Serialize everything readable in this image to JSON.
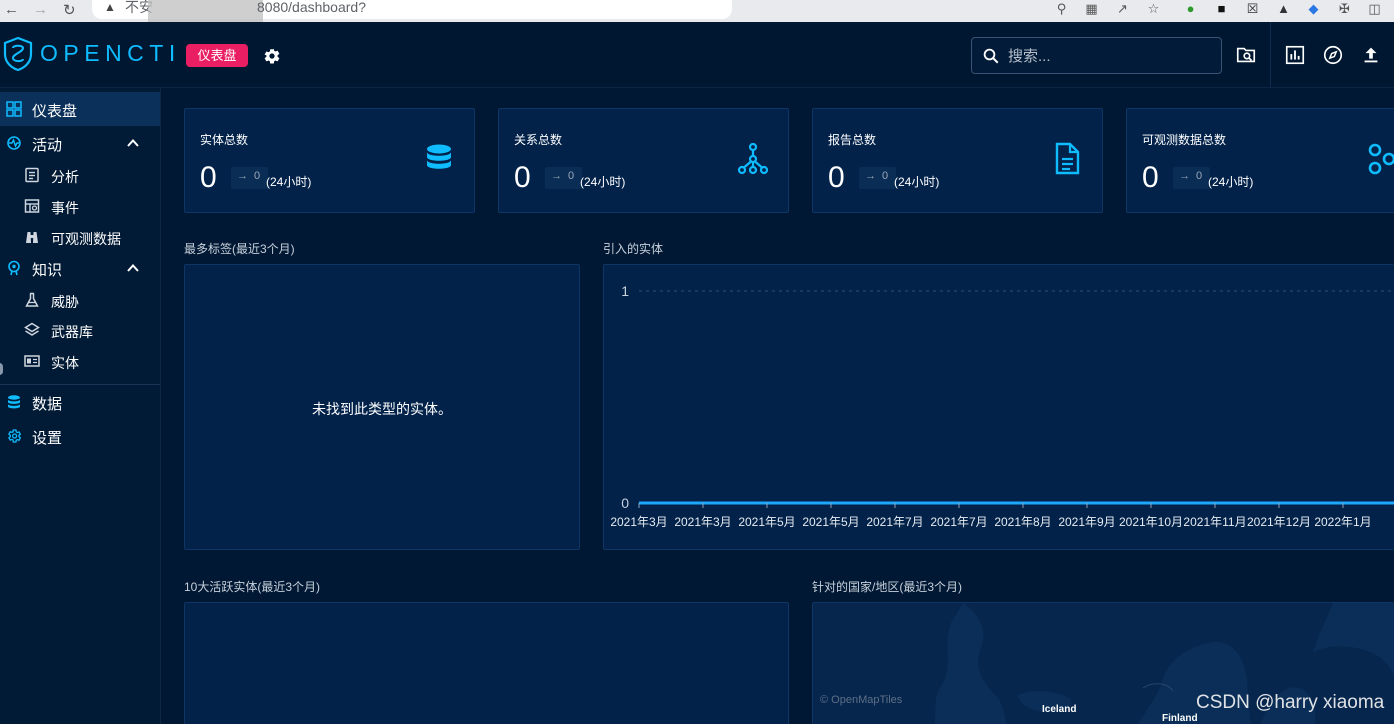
{
  "browser": {
    "insecure_label": "不安",
    "url": "8080/dashboard?"
  },
  "app": {
    "logo_text": "OPENCTI",
    "current_page_chip": "仪表盘",
    "search_placeholder": "搜索...",
    "accent": "#0fbcff",
    "chip_color": "#e91e63"
  },
  "sidebar": {
    "dashboard": "仪表盘",
    "activity": "活动",
    "activity_items": [
      "分析",
      "事件",
      "可观测数据"
    ],
    "knowledge": "知识",
    "knowledge_items": [
      "威胁",
      "武器库",
      "实体"
    ],
    "data": "数据",
    "settings": "设置"
  },
  "cards": [
    {
      "title": "实体总数",
      "value": "0",
      "delta": "0",
      "range": "(24小时)",
      "icon": "database-icon"
    },
    {
      "title": "关系总数",
      "value": "0",
      "delta": "0",
      "range": "(24小时)",
      "icon": "graph-icon"
    },
    {
      "title": "报告总数",
      "value": "0",
      "delta": "0",
      "range": "(24小时)",
      "icon": "document-icon"
    },
    {
      "title": "可观测数据总数",
      "value": "0",
      "delta": "0",
      "range": "(24小时)",
      "icon": "hub-icon"
    }
  ],
  "sections": {
    "top_labels": "最多标签(最近3个月)",
    "no_entities": "未找到此类型的实体。",
    "ingested_entities": "引入的实体",
    "top_active": "10大活跃实体(最近3个月)",
    "targeted_countries": "针对的国家/地区(最近3个月)"
  },
  "chart_data": {
    "type": "line",
    "categories": [
      "2021年3月",
      "2021年3月",
      "2021年5月",
      "2021年5月",
      "2021年7月",
      "2021年7月",
      "2021年8月",
      "2021年9月",
      "2021年10月",
      "2021年11月",
      "2021年12月",
      "2022年1月"
    ],
    "values": [
      0,
      0,
      0,
      0,
      0,
      0,
      0,
      0,
      0,
      0,
      0,
      0
    ],
    "y_ticks": [
      "1",
      "0"
    ],
    "ylim": [
      0,
      1
    ],
    "grid": true,
    "line_color": "#1ea7fd"
  },
  "map": {
    "credit": "© OpenMapTiles",
    "labels": [
      "Iceland",
      "Finland"
    ]
  },
  "watermark": "CSDN @harry xiaoma"
}
